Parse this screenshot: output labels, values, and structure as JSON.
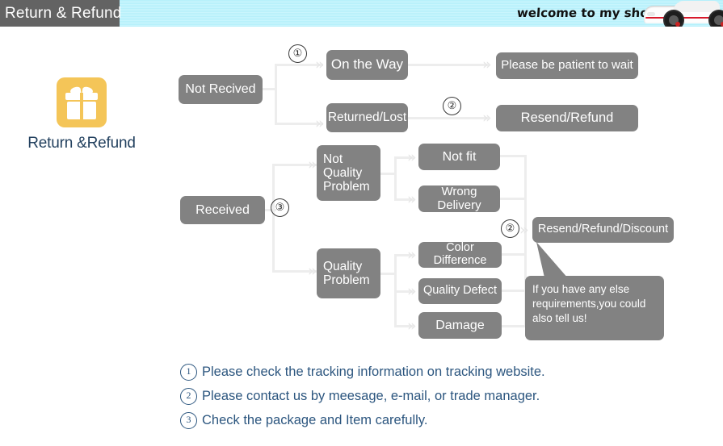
{
  "header": {
    "tab_title": "Return & Refund",
    "welcome_text": "welcome to my shop",
    "car_icon": "sports-car-icon",
    "stripe_color": "#c0f2fc",
    "tab_bg": "#636363"
  },
  "badge": {
    "icon": "gift-box-icon",
    "icon_color": "#f4c558",
    "label": "Return &Refund",
    "label_color": "#23415f"
  },
  "flow": {
    "node_color": "#828282",
    "connector_color": "#ededed",
    "nodes": [
      {
        "id": "not-received",
        "label": "Not Recived"
      },
      {
        "id": "on-the-way",
        "label": "On the Way"
      },
      {
        "id": "returned-lost",
        "label": "Returned/Lost"
      },
      {
        "id": "please-wait",
        "label": "Please be patient to wait"
      },
      {
        "id": "resend-refund",
        "label": "Resend/Refund"
      },
      {
        "id": "received",
        "label": "Received"
      },
      {
        "id": "not-quality",
        "label": "Not\nQuality\nProblem"
      },
      {
        "id": "not-fit",
        "label": "Not fit"
      },
      {
        "id": "wrong-delivery",
        "label": "Wrong Delivery"
      },
      {
        "id": "quality-problem",
        "label": "Quality\nProblem"
      },
      {
        "id": "color-difference",
        "label": "Color Difference"
      },
      {
        "id": "quality-defect",
        "label": "Quality Defect"
      },
      {
        "id": "damage",
        "label": "Damage"
      },
      {
        "id": "resend-refund-discount",
        "label": "Resend/Refund/Discount"
      }
    ],
    "markers": {
      "one_top": "①",
      "two_top": "②",
      "three_mid": "③",
      "two_right": "②"
    },
    "callout": "If you have any else requirements,you could also tell us!"
  },
  "notes": {
    "text_color": "#2c567f",
    "items": [
      {
        "num": "1",
        "text": "Please check the tracking information on tracking website."
      },
      {
        "num": "2",
        "text": "Please contact us by meesage, e-mail, or trade manager."
      },
      {
        "num": "3",
        "text": "Check the package and Item carefully."
      }
    ]
  }
}
